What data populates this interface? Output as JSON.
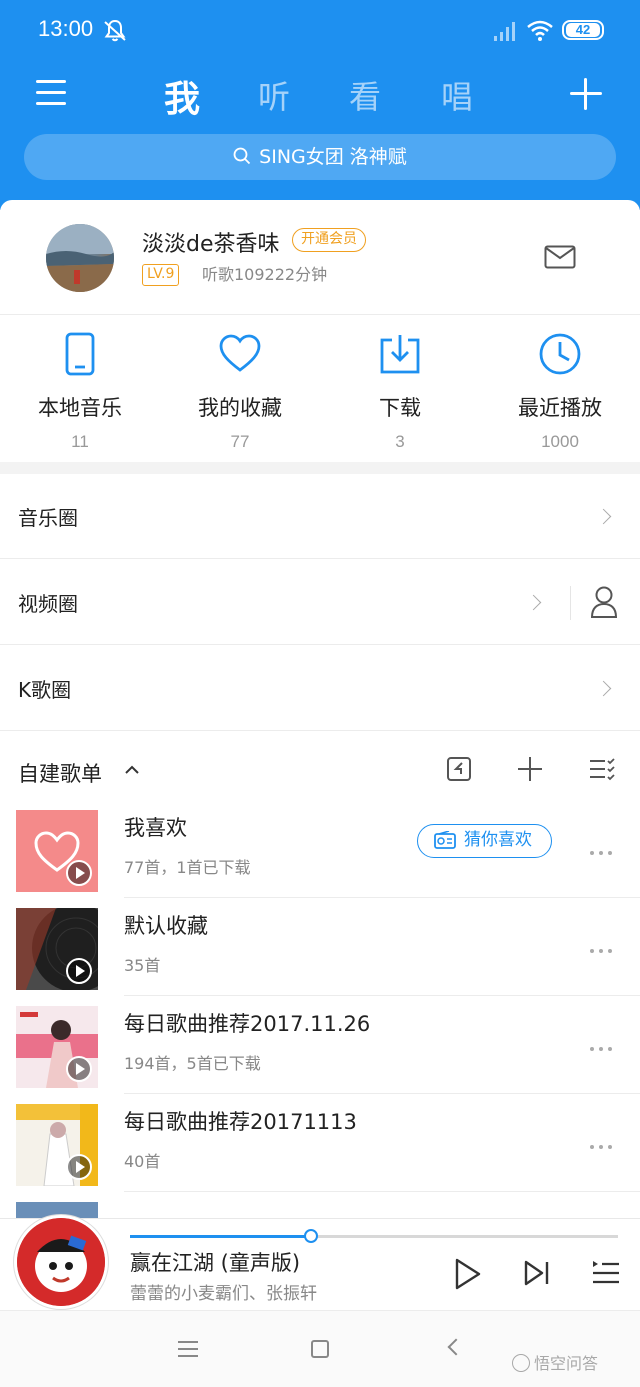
{
  "status_bar": {
    "time": "13:00",
    "battery": "42"
  },
  "top_nav": {
    "tabs": [
      {
        "label": "我",
        "active": true
      },
      {
        "label": "听",
        "active": false
      },
      {
        "label": "看",
        "active": false
      },
      {
        "label": "唱",
        "active": false
      }
    ]
  },
  "search": {
    "placeholder": "SING女团 洛神赋"
  },
  "profile": {
    "username": "淡淡de茶香味",
    "vip_label": "开通会员",
    "level": "LV.9",
    "listen_time": "听歌109222分钟"
  },
  "quick_access": [
    {
      "label": "本地音乐",
      "count": "11",
      "icon": "phone-icon"
    },
    {
      "label": "我的收藏",
      "count": "77",
      "icon": "heart-icon"
    },
    {
      "label": "下载",
      "count": "3",
      "icon": "download-icon"
    },
    {
      "label": "最近播放",
      "count": "1000",
      "icon": "clock-icon"
    }
  ],
  "circles": [
    {
      "label": "音乐圈"
    },
    {
      "label": "视频圈"
    },
    {
      "label": "K歌圈"
    }
  ],
  "playlists_section": {
    "title": "自建歌单"
  },
  "playlists": [
    {
      "name": "我喜欢",
      "sub": "77首，1首已下载",
      "action": "猜你喜欢"
    },
    {
      "name": "默认收藏",
      "sub": "35首"
    },
    {
      "name": "每日歌曲推荐2017.11.26",
      "sub": "194首，5首已下载"
    },
    {
      "name": "每日歌曲推荐20171113",
      "sub": "40首"
    }
  ],
  "player": {
    "title": "赢在江湖 (童声版)",
    "artist": "蕾蕾的小麦霸们、张振轩",
    "progress": 0.37
  },
  "watermark": "悟空问答",
  "colors": {
    "accent": "#1e90f0",
    "vip": "#f0a020"
  }
}
